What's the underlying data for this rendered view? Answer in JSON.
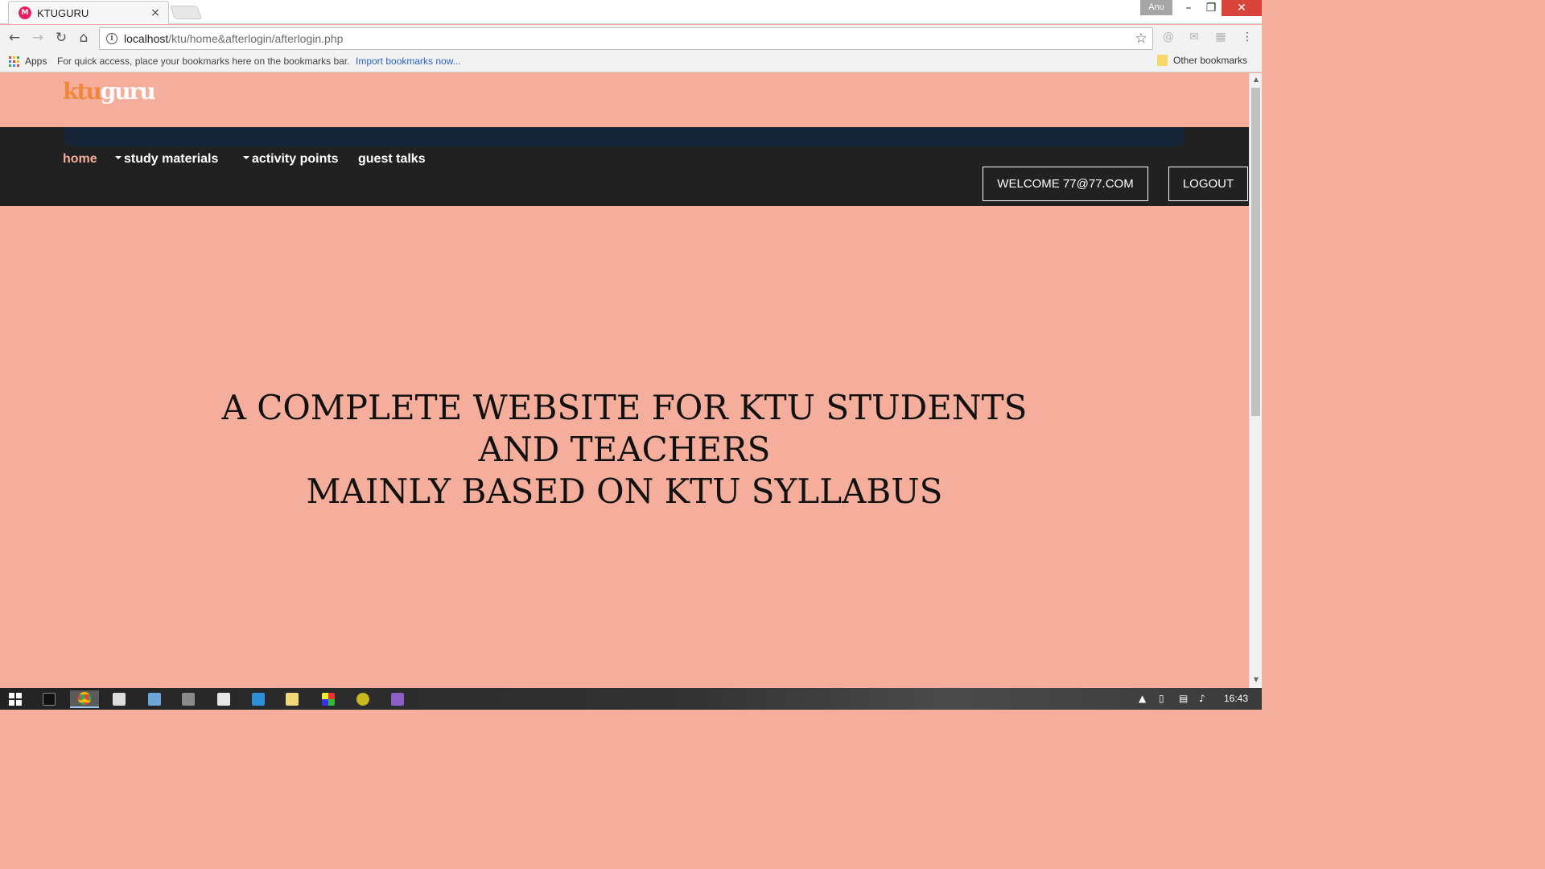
{
  "browser": {
    "tab_title": "KTUGURU",
    "tab_favicon": "M",
    "tab_close": "×",
    "profile_name": "Anu",
    "url_host": "localhost",
    "url_path": "/ktu/home&afterlogin/afterlogin.php",
    "bookmarks_apps": "Apps",
    "bookmarks_hint": "For quick access, place your bookmarks here on the bookmarks bar.",
    "bookmarks_import": "Import bookmarks now...",
    "other_bookmarks": "Other bookmarks",
    "window_buttons": {
      "minimize": "–",
      "maximize": "❐",
      "close": "✕"
    }
  },
  "site": {
    "logo_part1": "ktu",
    "logo_part2": "guru",
    "nav": [
      {
        "label": "home",
        "active": true
      },
      {
        "label": "study materials",
        "dropdown": true
      },
      {
        "label": "activity points",
        "dropdown": true
      },
      {
        "label": "guest talks"
      }
    ],
    "welcome_button": "WELCOME 77@77.COM",
    "logout_button": "LOGOUT",
    "hero_line1": "A COMPLETE WEBSITE FOR KTU STUDENTS AND TEACHERS",
    "hero_line2": "MAINLY BASED ON KTU SYLLABUS"
  },
  "taskbar": {
    "clock": "16:43",
    "app_icons": [
      "terminal-icon",
      "chrome-icon",
      "bo-icon",
      "chart-icon",
      "network-icon",
      "document-icon",
      "remote-icon",
      "notes-icon",
      "paint-icon",
      "app15-icon",
      "visual-studio-icon"
    ]
  },
  "colors": {
    "page_bg": "#f5ad9c",
    "navbar_bg": "#212121",
    "navbar_strip": "#172539",
    "logo_accent": "#f0883b",
    "active_nav": "#f5ad9c"
  }
}
